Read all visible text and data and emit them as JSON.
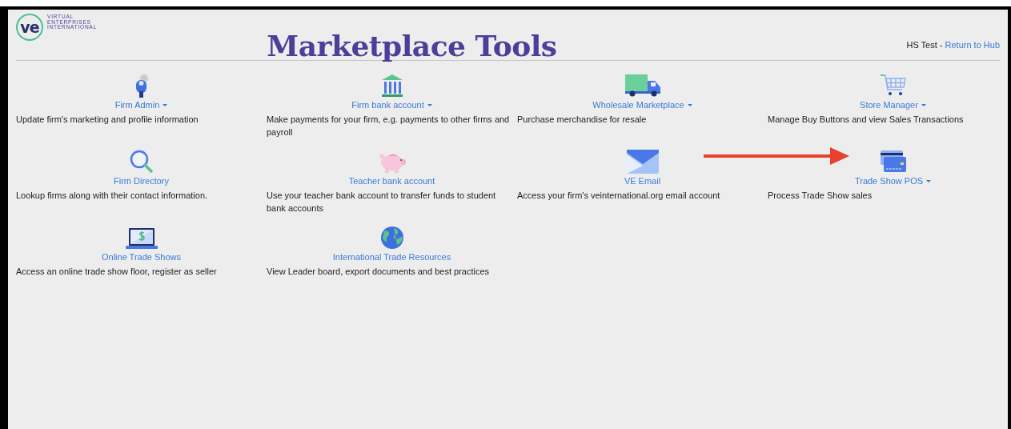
{
  "logo": {
    "mark": "ve",
    "lines": [
      "VIRTUAL",
      "ENTERPRISES",
      "INTERNATIONAL"
    ]
  },
  "title": "Marketplace Tools",
  "user": {
    "name": "HS Test -",
    "link": "Return to Hub"
  },
  "tools": [
    {
      "label": "Firm Admin",
      "has_menu": true,
      "description": "Update firm's marketing and profile information"
    },
    {
      "label": "Firm bank account",
      "has_menu": true,
      "description": "Make payments for your firm, e.g. payments to other firms and payroll"
    },
    {
      "label": "Wholesale Marketplace",
      "has_menu": true,
      "description": "Purchase merchandise for resale"
    },
    {
      "label": "Store Manager",
      "has_menu": true,
      "description": "Manage Buy Buttons and view Sales Transactions"
    },
    {
      "label": "Firm Directory",
      "has_menu": false,
      "description": "Lookup firms along with their contact information."
    },
    {
      "label": "Teacher bank account",
      "has_menu": false,
      "description": "Use your teacher bank account to transfer funds to student bank accounts"
    },
    {
      "label": "VE Email",
      "has_menu": false,
      "description": "Access your firm's veinternational.org email account"
    },
    {
      "label": "Trade Show POS",
      "has_menu": true,
      "description": "Process Trade Show sales"
    },
    {
      "label": "Online Trade Shows",
      "has_menu": false,
      "description": "Access an online trade show floor, register as seller"
    },
    {
      "label": "International Trade Resources",
      "has_menu": false,
      "description": "View Leader board, export documents and best practices"
    }
  ]
}
